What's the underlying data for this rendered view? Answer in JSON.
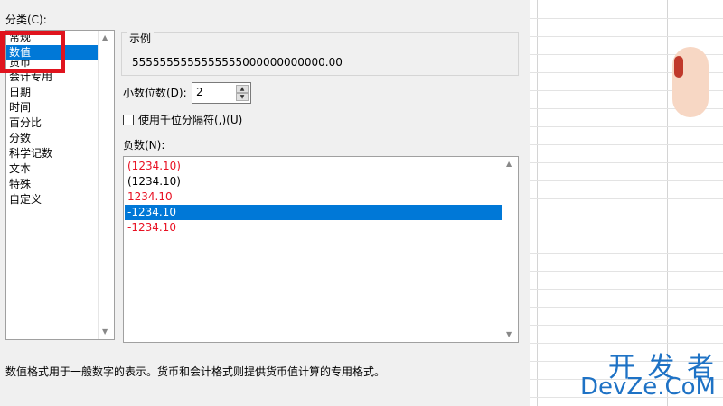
{
  "category": {
    "label": "分类(C):",
    "items": [
      "常规",
      "数值",
      "货币",
      "会计专用",
      "日期",
      "时间",
      "百分比",
      "分数",
      "科学记数",
      "文本",
      "特殊",
      "自定义"
    ],
    "selected_index": 1
  },
  "sample": {
    "legend": "示例",
    "value": "5555555555555555000000000000.00"
  },
  "decimals": {
    "label": "小数位数(D):",
    "value": "2"
  },
  "thousands": {
    "label": "使用千位分隔符(,)(U)",
    "checked": false
  },
  "negative": {
    "label": "负数(N):",
    "items": [
      {
        "text": "(1234.10)",
        "color": "#e81123"
      },
      {
        "text": "(1234.10)",
        "color": "#000000"
      },
      {
        "text": "1234.10",
        "color": "#e81123"
      },
      {
        "text": "-1234.10",
        "color": "#ffffff"
      },
      {
        "text": "-1234.10",
        "color": "#e81123"
      }
    ],
    "selected_index": 3
  },
  "description": "数值格式用于一般数字的表示。货币和会计格式则提供货币值计算的专用格式。",
  "watermark": {
    "line1": "开 发 者",
    "line2": "DevZe.CoM"
  },
  "colors": {
    "selection": "#0078d7",
    "highlight": "#e0141e",
    "negative_red": "#e81123"
  }
}
